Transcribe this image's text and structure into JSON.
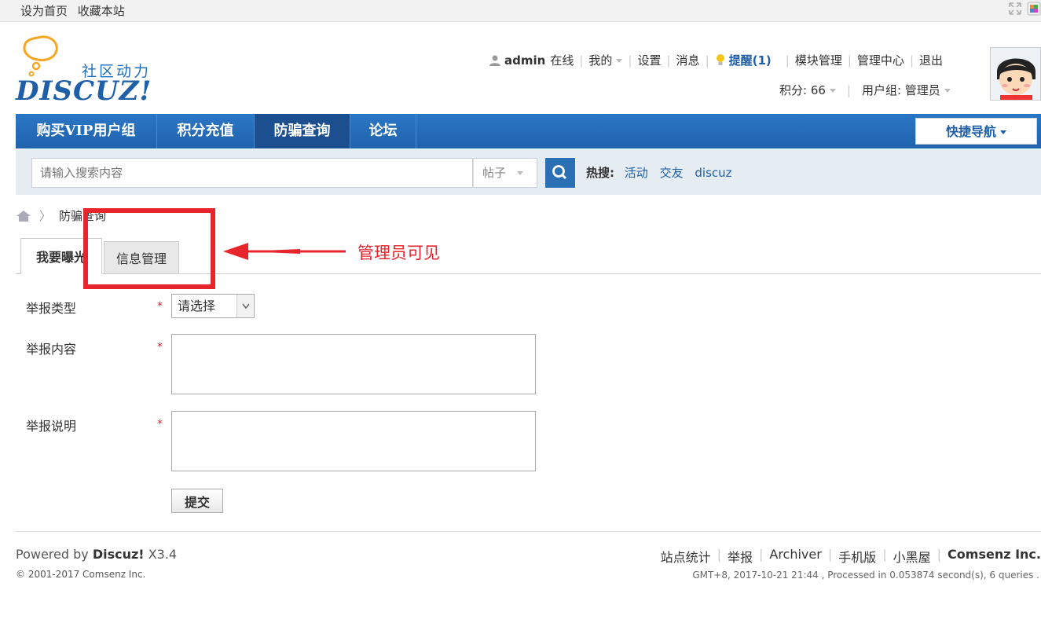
{
  "topbar": {
    "set_home": "设为首页",
    "bookmark": "收藏本站"
  },
  "logo": {
    "slogan": "社区动力",
    "brand": "DISCUZ!"
  },
  "userbar": {
    "username": "admin",
    "online": "在线",
    "mine": "我的",
    "settings": "设置",
    "messages": "消息",
    "notice": "提醒(1)",
    "module_manage": "模块管理",
    "admin_center": "管理中心",
    "logout": "退出",
    "credits": "积分: 66",
    "usergroup": "用户组: 管理员"
  },
  "nav": {
    "items": [
      {
        "label": "购买VIP用户组"
      },
      {
        "label": "积分充值"
      },
      {
        "label": "防骗查询"
      },
      {
        "label": "论坛"
      }
    ],
    "active_index": 2,
    "quick_nav": "快捷导航"
  },
  "search": {
    "placeholder": "请输入搜索内容",
    "type": "帖子",
    "hot_label": "热搜:",
    "hot_words": [
      "活动",
      "交友",
      "discuz"
    ]
  },
  "breadcrumb": {
    "current": "防骗查询"
  },
  "tabs": {
    "expose": "我要曝光",
    "manage": "信息管理"
  },
  "annotation": {
    "text": "管理员可见"
  },
  "form": {
    "type_label": "举报类型",
    "type_value": "请选择",
    "content_label": "举报内容",
    "desc_label": "举报说明",
    "required_mark": "*",
    "submit": "提交"
  },
  "footer": {
    "powered_prefix": "Powered by ",
    "powered_brand": "Discuz!",
    "powered_version": " X3.4",
    "copyright": "© 2001-2017 Comsenz Inc.",
    "links": [
      "站点统计",
      "举报",
      "Archiver",
      "手机版",
      "小黑屋"
    ],
    "company": "Comsenz Inc.",
    "meta": "GMT+8, 2017-10-21 21:44 , Processed in 0.053874 second(s), 6 queries ."
  },
  "colors": {
    "nav_bg": "#2266b0",
    "nav_active": "#1b4f8f",
    "link_blue": "#1f5fa8",
    "annotation_red": "#e8242c"
  }
}
